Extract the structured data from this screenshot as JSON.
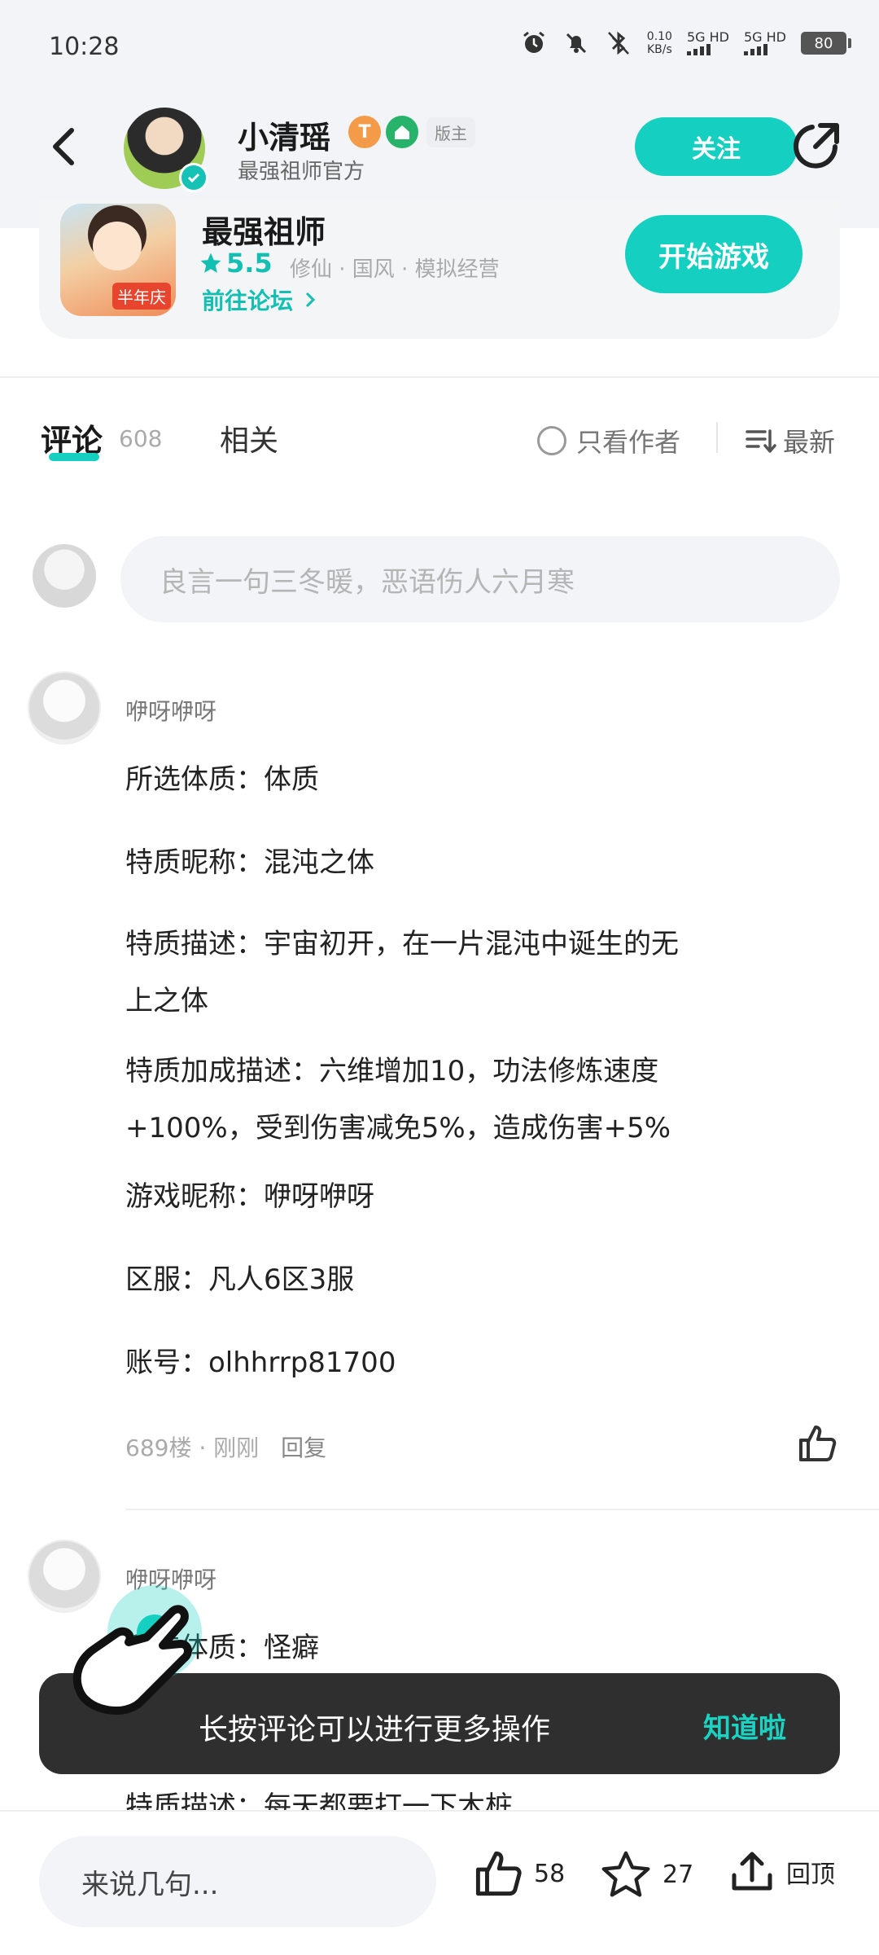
{
  "status_bar": {
    "time": "10:28",
    "net_speed_value": "0.10",
    "net_speed_unit": "KB/s",
    "signal1": "5G HD",
    "signal2": "5G HD",
    "battery": "80"
  },
  "header": {
    "name": "小清瑶",
    "badge_t": "T",
    "badge_role": "版主",
    "subtitle": "最强祖师官方",
    "follow_label": "关注"
  },
  "game": {
    "name": "最强祖师",
    "score": "5.5",
    "tags": "修仙 · 国风 · 模拟经营",
    "forum_link": "前往论坛",
    "icon_tag": "半年庆",
    "start_label": "开始游戏"
  },
  "tabs": {
    "comment_label": "评论",
    "comment_count": "608",
    "related_label": "相关",
    "only_author_label": "只看作者",
    "sort_label": "最新"
  },
  "comment_input": {
    "placeholder": "良言一句三冬暖，恶语伤人六月寒"
  },
  "posts": [
    {
      "user": "咿呀咿呀",
      "lines": [
        "所选体质：体质",
        "特质昵称：混沌之体",
        "特质描述：宇宙初开，在一片混沌中诞生的无",
        "上之体",
        "特质加成描述：六维增加10，功法修炼速度",
        "+100%，受到伤害减免5%，造成伤害+5%",
        "游戏昵称：咿呀咿呀",
        "区服：凡人6区3服",
        "账号：olhhrrp81700"
      ],
      "meta": "689楼 · 刚刚",
      "reply_label": "回复"
    },
    {
      "user": "咿呀咿呀",
      "lines": [
        "所选体质：怪癖",
        "特质描述：每天都要打一下木桩"
      ]
    }
  ],
  "toast": {
    "message": "长按评论可以进行更多操作",
    "action": "知道啦"
  },
  "bottom_bar": {
    "say_placeholder": "来说几句...",
    "likes": "58",
    "favorites": "27",
    "top_label": "回顶"
  },
  "colors": {
    "accent": "#15cfc0",
    "toast_bg": "#2f2f2f",
    "header_bg": "#f2f4f7"
  }
}
